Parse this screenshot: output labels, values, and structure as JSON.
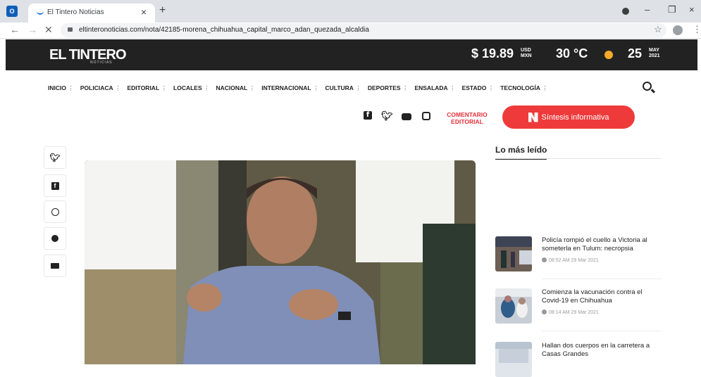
{
  "browser": {
    "tab_title": "El Tintero Noticias",
    "url": "eltinteronoticias.com/nota/42185-morena_chihuahua_capital_marco_adan_quezada_alcaldia"
  },
  "header": {
    "logo_text": "EL TINTERO",
    "logo_sub": "NOTICIAS",
    "currency_value": "$ 19.89",
    "currency_unit_top": "USD",
    "currency_unit_bottom": "MXN",
    "temperature": "30 °C",
    "day": "25",
    "month": "MAY",
    "year": "2021"
  },
  "menu": [
    {
      "label": "INICIO"
    },
    {
      "label": "POLICIACA"
    },
    {
      "label": "EDITORIAL"
    },
    {
      "label": "LOCALES"
    },
    {
      "label": "NACIONAL"
    },
    {
      "label": "INTERNACIONAL"
    },
    {
      "label": "CULTURA"
    },
    {
      "label": "DEPORTES"
    },
    {
      "label": "ENSALADA"
    },
    {
      "label": "ESTADO"
    },
    {
      "label": "TECNOLOGÍA"
    }
  ],
  "subheader": {
    "comentario": "COMENTARIO EDITORIAL",
    "sintesis": "Síntesis informativa"
  },
  "most_read": {
    "title": "Lo más leído",
    "items": [
      {
        "title": "Policía rompió el cuello a Victoria al someterla en Tulum: necropsia",
        "time": "08:52 AM 29 Mar 2021"
      },
      {
        "title": "Comienza la vacunación contra el Covid-19 en Chihuahua",
        "time": "08:14 AM 29 Mar 2021"
      },
      {
        "title": "Hallan dos cuerpos en la carretera a Casas Grandes",
        "time": ""
      }
    ]
  }
}
